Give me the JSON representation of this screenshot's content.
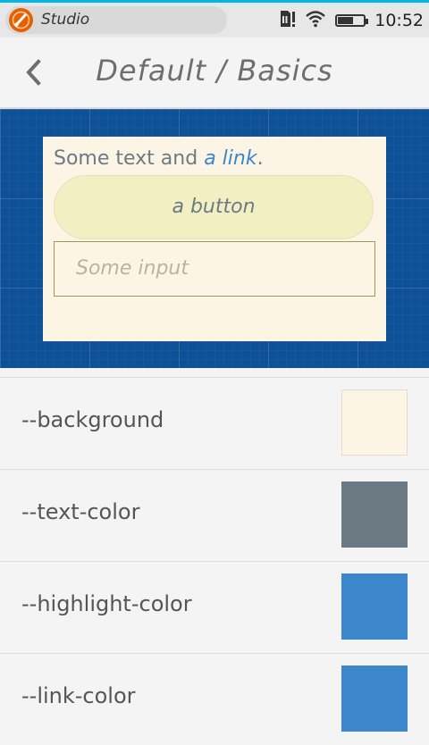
{
  "status_bar": {
    "app_name": "Studio",
    "time": "10:52",
    "battery_level": 0.55
  },
  "header": {
    "title": "Default / Basics"
  },
  "preview": {
    "text_before_link": "Some text and ",
    "link_text": "a link",
    "text_after_link": ".",
    "button_label": "a button",
    "input_placeholder": "Some input"
  },
  "variables": [
    {
      "name": "--background",
      "color": "#fcf5e6"
    },
    {
      "name": "--text-color",
      "color": "#6c7a83"
    },
    {
      "name": "--highlight-color",
      "color": "#3c86cc"
    },
    {
      "name": "--link-color",
      "color": "#3c86cc"
    }
  ],
  "colors": {
    "accent_bar": "#00b7e8",
    "preview_background": "#0f5196",
    "button_background": "#f2efc3",
    "input_border": "#9b9a55"
  }
}
